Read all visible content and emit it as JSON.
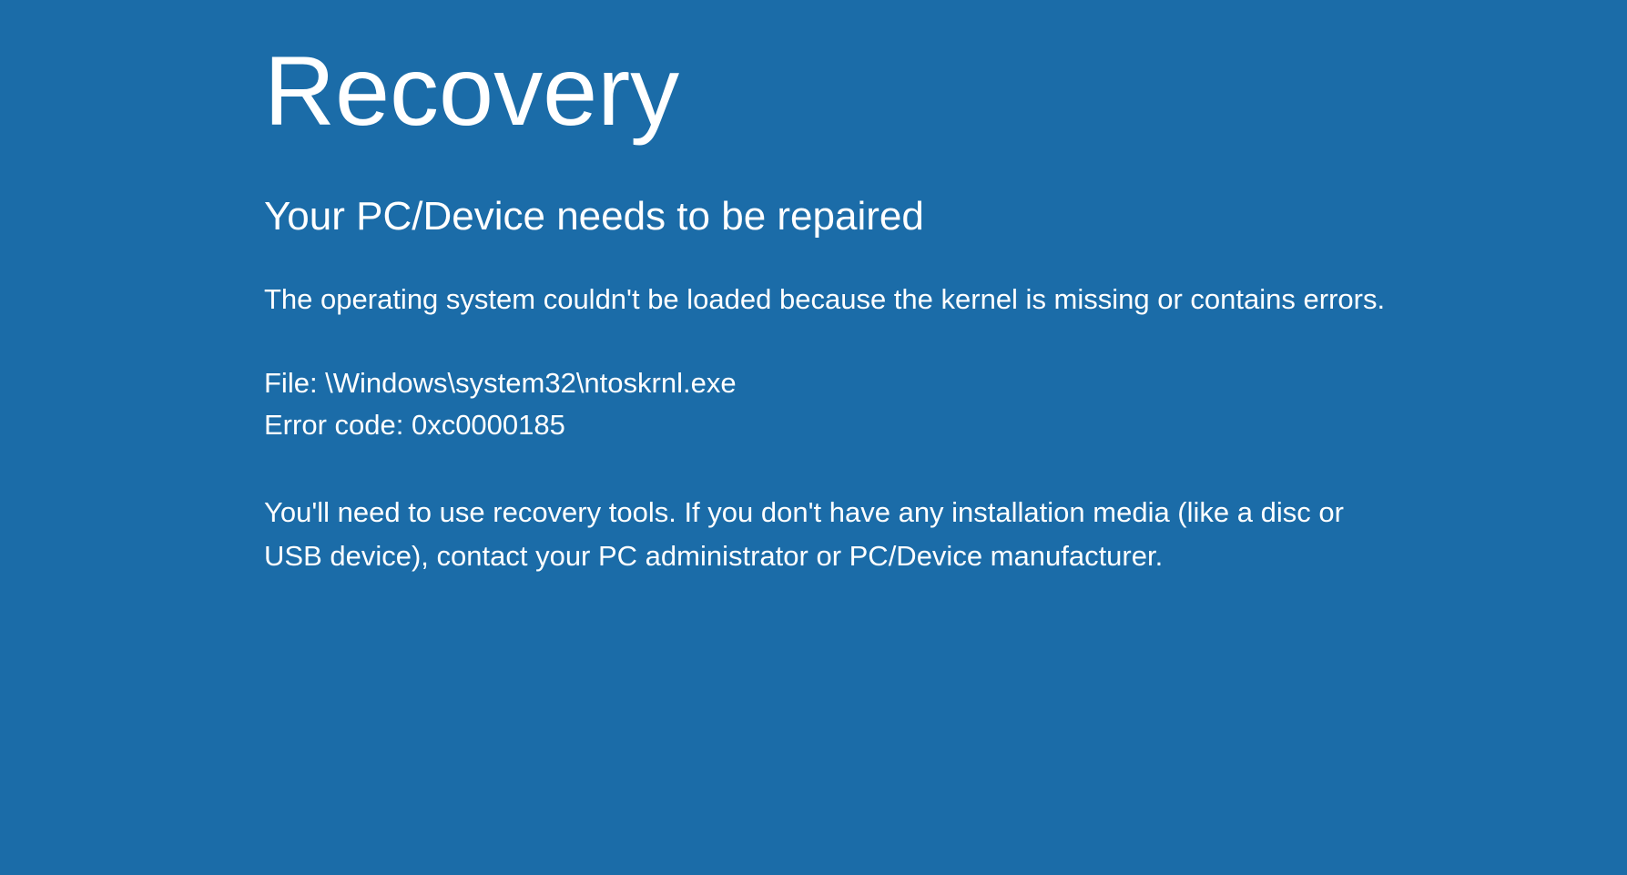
{
  "recovery": {
    "title": "Recovery",
    "subtitle": "Your PC/Device needs to be repaired",
    "message": "The operating system couldn't be loaded because the kernel is missing or contains errors.",
    "file_line": "File: \\Windows\\system32\\ntoskrnl.exe",
    "error_code_line": "Error code: 0xc0000185",
    "instructions": "You'll need to use recovery tools. If you don't have any installation media (like a disc or USB device), contact your PC administrator or PC/Device manufacturer."
  }
}
